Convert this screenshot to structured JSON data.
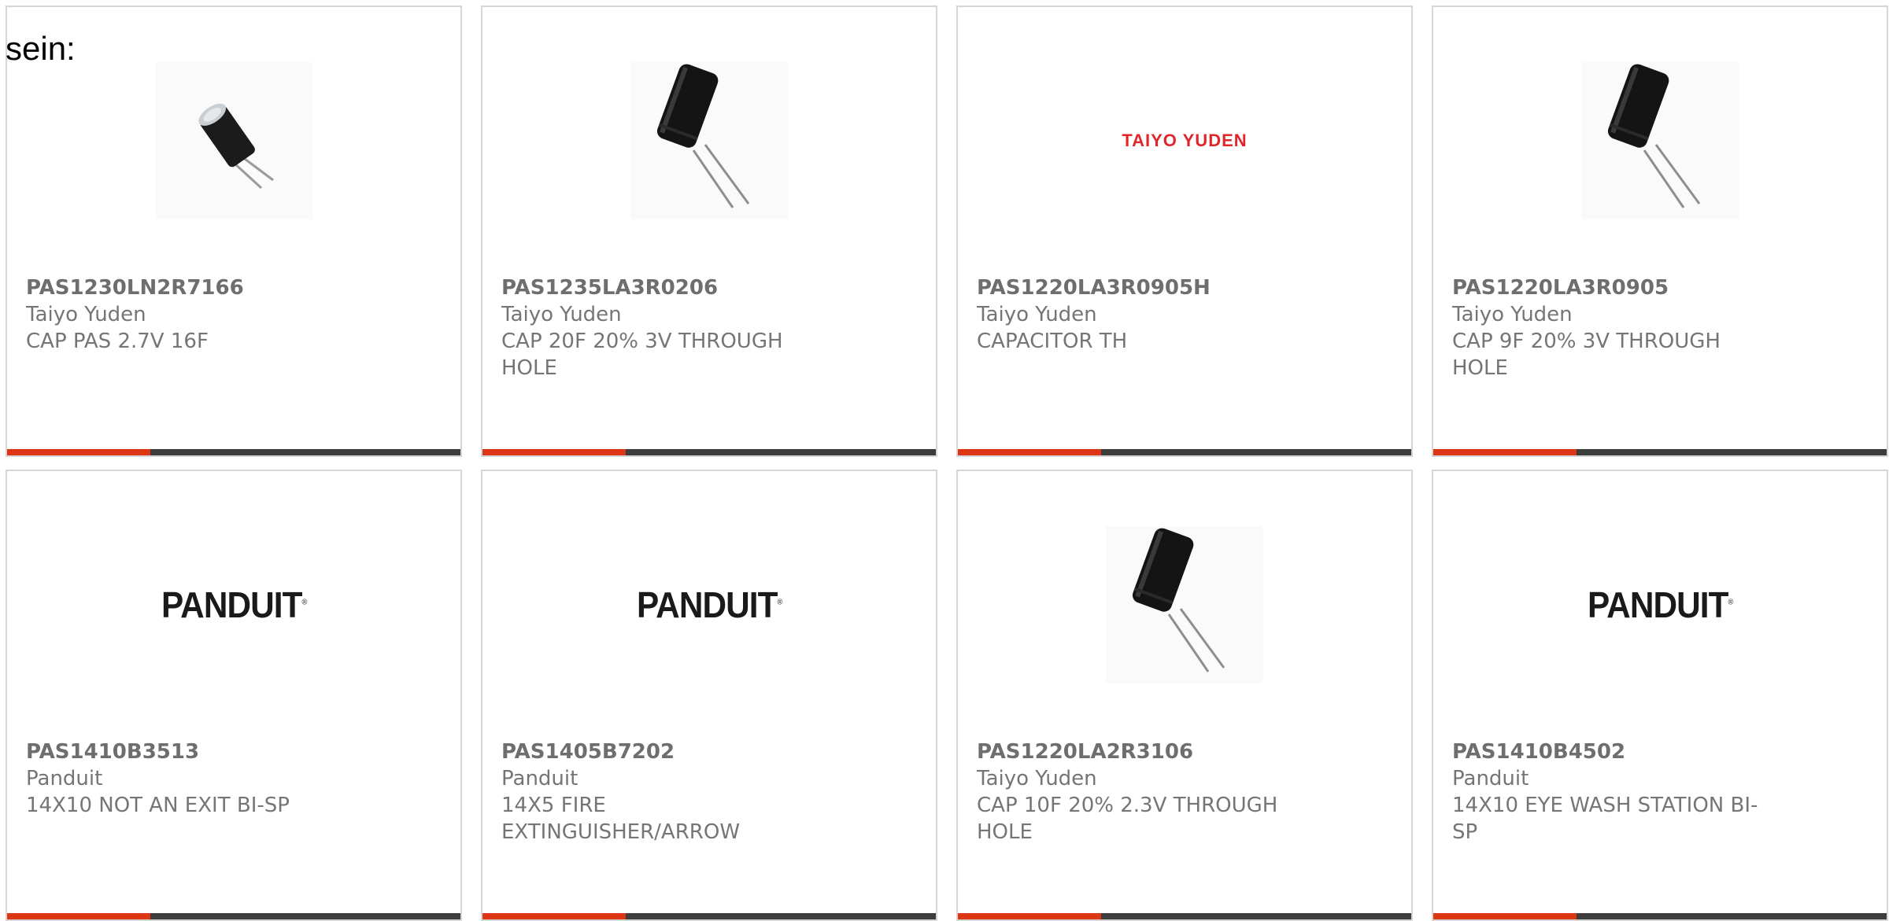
{
  "page": {
    "top_text": "sein:"
  },
  "colors": {
    "accent": "#dd3614",
    "bar_dark": "#3d3d3d",
    "text": "#757575",
    "taiyo_logo": "#e0262b"
  },
  "cards": [
    {
      "part_number": "PAS1230LN2R7166",
      "manufacturer": "Taiyo Yuden",
      "description": "CAP PAS 2.7V 16F",
      "image": "small-capacitor-photo"
    },
    {
      "part_number": "PAS1235LA3R0206",
      "manufacturer": "Taiyo Yuden",
      "description": "CAP 20F 20% 3V THROUGH HOLE",
      "image": "capacitor-photo"
    },
    {
      "part_number": "PAS1220LA3R0905H",
      "manufacturer": "Taiyo Yuden",
      "description": "CAPACITOR TH",
      "image": "taiyo-yuden-logo",
      "logo_text": "TAIYO YUDEN"
    },
    {
      "part_number": "PAS1220LA3R0905",
      "manufacturer": "Taiyo Yuden",
      "description": "CAP 9F 20% 3V THROUGH HOLE",
      "image": "capacitor-photo"
    },
    {
      "part_number": "PAS1410B3513",
      "manufacturer": "Panduit",
      "description": "14X10 NOT AN EXIT BI-SP",
      "image": "panduit-logo",
      "logo_text": "PANDUIT"
    },
    {
      "part_number": "PAS1405B7202",
      "manufacturer": "Panduit",
      "description": "14X5 FIRE EXTINGUISHER/ARROW",
      "image": "panduit-logo",
      "logo_text": "PANDUIT"
    },
    {
      "part_number": "PAS1220LA2R3106",
      "manufacturer": "Taiyo Yuden",
      "description": "CAP 10F 20% 2.3V THROUGH HOLE",
      "image": "capacitor-photo"
    },
    {
      "part_number": "PAS1410B4502",
      "manufacturer": "Panduit",
      "description": "14X10 EYE WASH STATION BI-SP",
      "image": "panduit-logo",
      "logo_text": "PANDUIT"
    }
  ]
}
